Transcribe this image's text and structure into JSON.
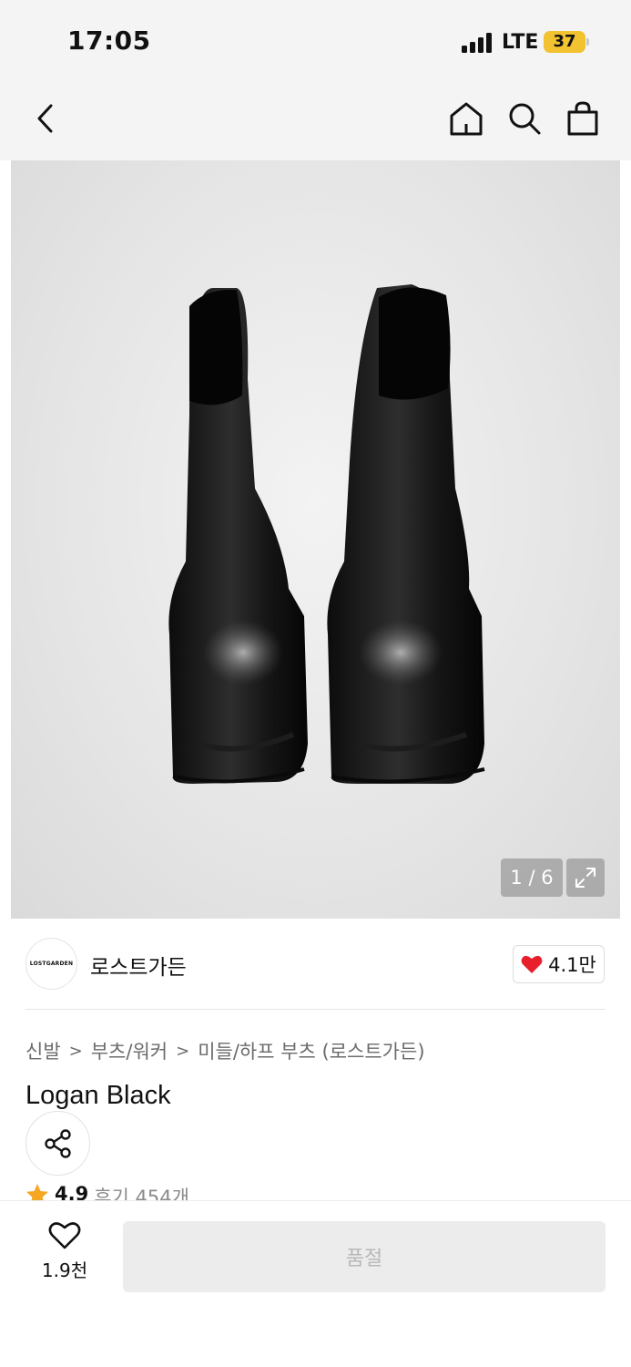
{
  "status_bar": {
    "time": "17:05",
    "network": "LTE",
    "battery": "37"
  },
  "header": {
    "icons": [
      "chevron-left-icon",
      "home-icon",
      "search-icon",
      "shopping-bag-icon"
    ]
  },
  "gallery": {
    "counter": "1 / 6",
    "expand_icon": "expand-icon"
  },
  "brand": {
    "logo_text": "LOSTGARDEN",
    "name": "로스트가든",
    "likes": "4.1만",
    "heart_color": "#e8202b"
  },
  "breadcrumb": [
    "신발",
    "부츠/워커",
    "미들/하프 부츠 (로스트가든)"
  ],
  "product": {
    "title": "Logan Black"
  },
  "rating": {
    "score": "4.9",
    "reviews": "후기 454개",
    "star_color": "#f5a623"
  },
  "bottom_bar": {
    "wish_count": "1.9천",
    "soldout_label": "품절"
  }
}
